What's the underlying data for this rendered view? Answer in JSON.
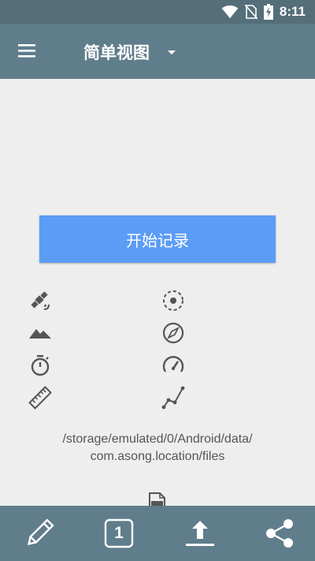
{
  "status_bar": {
    "time": "8:11",
    "icons": [
      "wifi-icon",
      "no-sim-icon",
      "battery-charging-icon"
    ]
  },
  "app_bar": {
    "title": "简单视图",
    "icons": [
      "menu-icon",
      "dropdown-arrow-icon"
    ]
  },
  "main": {
    "start_button_label": "开始记录",
    "indicators_left": [
      "satellite-icon",
      "mountain-icon",
      "stopwatch-icon",
      "ruler-icon"
    ],
    "indicators_right": [
      "gps-accuracy-icon",
      "compass-icon",
      "speedometer-icon",
      "track-path-icon"
    ],
    "storage_path_line1": "/storage/emulated/0/Android/data/",
    "storage_path_line2": "com.asong.location/files",
    "file_icon": "gpx-file-icon"
  },
  "bottom_bar": {
    "counter_value": "1",
    "icons": [
      "edit-icon",
      "counter-icon",
      "upload-icon",
      "share-icon"
    ]
  },
  "colors": {
    "status_bar": "#546e7a",
    "app_bar": "#607d8b",
    "bottom_bar": "#607d8b",
    "background": "#eeeeee",
    "accent_button": "#5b9cf6",
    "icon_gray": "#555555"
  }
}
